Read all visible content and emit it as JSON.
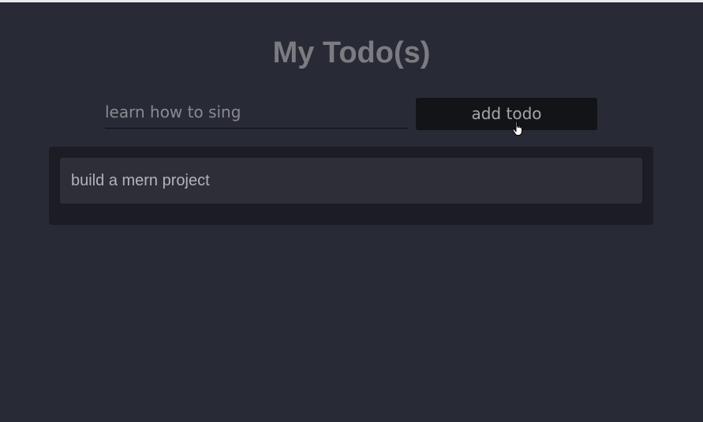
{
  "app": {
    "title": "My Todo(s)"
  },
  "form": {
    "input_value": "learn how to sing",
    "input_placeholder": "",
    "add_label": "add todo"
  },
  "todos": [
    {
      "text": "build a mern project"
    }
  ],
  "colors": {
    "background": "#282a36",
    "panel": "#1b1c24",
    "item": "#2d2e38",
    "button": "#131417",
    "title": "#7b7b80"
  },
  "icons": {
    "cursor": "hand-pointer-icon"
  }
}
